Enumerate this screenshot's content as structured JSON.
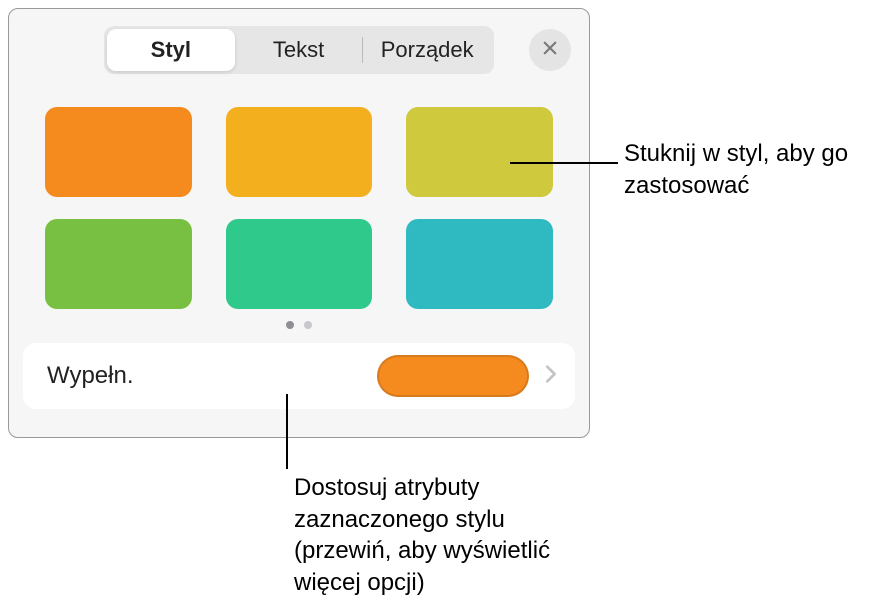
{
  "tabs": {
    "style": "Styl",
    "text": "Tekst",
    "arrange": "Porządek"
  },
  "swatches": {
    "colors": [
      "#f58b1f",
      "#f3af1e",
      "#cfca3d",
      "#78c042",
      "#2ec98b",
      "#2fb9c0"
    ]
  },
  "pager": {
    "count": 2,
    "active": 0
  },
  "fill": {
    "label": "Wypełn.",
    "preview_color": "#f58b1f"
  },
  "callouts": {
    "apply": "Stuknij w styl, aby go zastosować",
    "customize": "Dostosuj atrybuty zaznaczonego stylu (przewiń, aby wyświetlić więcej opcji)"
  }
}
